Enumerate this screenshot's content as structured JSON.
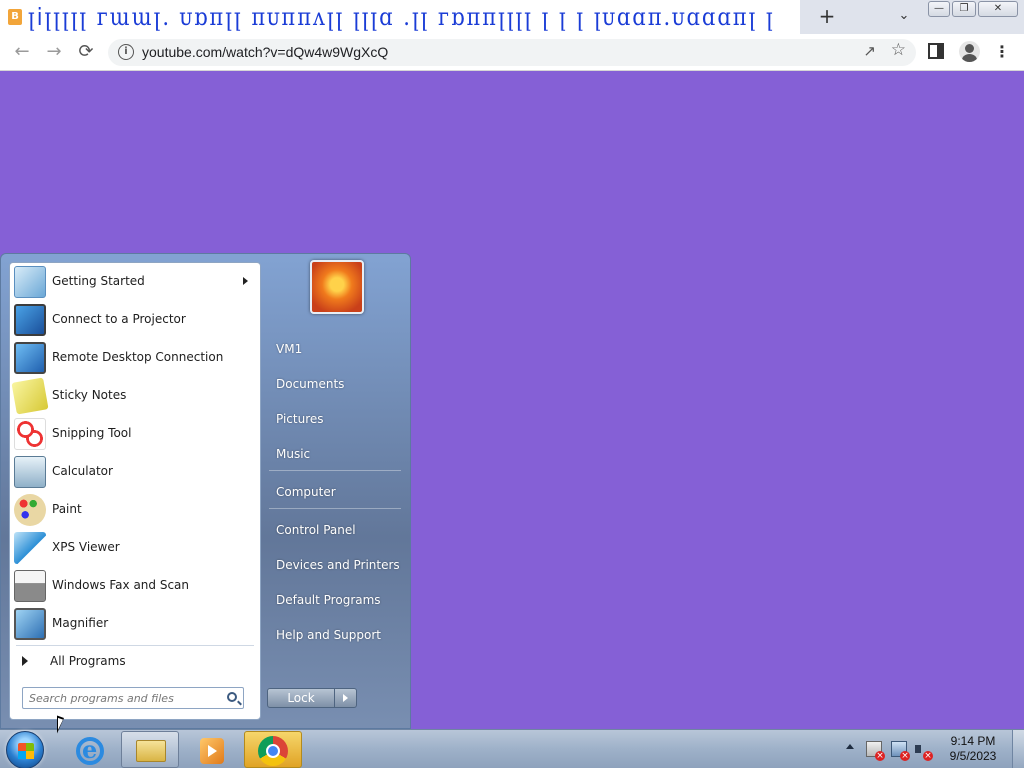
{
  "browser": {
    "tab_title": "ꞁ𝗂ꞁꞁꞁꞁꞁ ᴦɯɯꞁ. ᴜɒᴨꞁꞁ ᴨᴜᴨᴨᴧꞁꞁ ꞁꞁꞁɑ .ꞁꞁ ᴦɒᴨᴨꞁꞁꞁꞁ ꞁ ꞁ ꞁ ꞁᴜɑɑᴨ.ᴜɑɑɑᴨꞁ ꞁ",
    "favicon_letter": "B",
    "new_tab_symbol": "+",
    "url": "youtube.com/watch?v=dQw4w9WgXcQ"
  },
  "start_menu": {
    "programs": [
      {
        "label": "Getting Started",
        "icon": "getting-started-icon",
        "has_submenu": true
      },
      {
        "label": "Connect to a Projector",
        "icon": "projector-icon"
      },
      {
        "label": "Remote Desktop Connection",
        "icon": "remote-desktop-icon"
      },
      {
        "label": "Sticky Notes",
        "icon": "sticky-notes-icon"
      },
      {
        "label": "Snipping Tool",
        "icon": "scissors-icon"
      },
      {
        "label": "Calculator",
        "icon": "calculator-icon"
      },
      {
        "label": "Paint",
        "icon": "paint-palette-icon"
      },
      {
        "label": "XPS Viewer",
        "icon": "xps-viewer-icon"
      },
      {
        "label": "Windows Fax and Scan",
        "icon": "fax-icon"
      },
      {
        "label": "Magnifier",
        "icon": "magnifier-icon"
      }
    ],
    "all_programs": "All Programs",
    "search_placeholder": "Search programs and files",
    "right_items": {
      "user": "VM1",
      "documents": "Documents",
      "pictures": "Pictures",
      "music": "Music",
      "computer": "Computer",
      "control_panel": "Control Panel",
      "devices": "Devices and Printers",
      "default_programs": "Default Programs",
      "help": "Help and Support"
    },
    "lock_label": "Lock"
  },
  "taskbar": {
    "apps": [
      "internet-explorer-icon",
      "file-explorer-icon",
      "media-player-icon",
      "chrome-icon"
    ],
    "time": "9:14 PM",
    "date": "9/5/2023"
  },
  "colors": {
    "desktop_background": "#8560d6",
    "tab_title_text": "#1a3cd6"
  }
}
